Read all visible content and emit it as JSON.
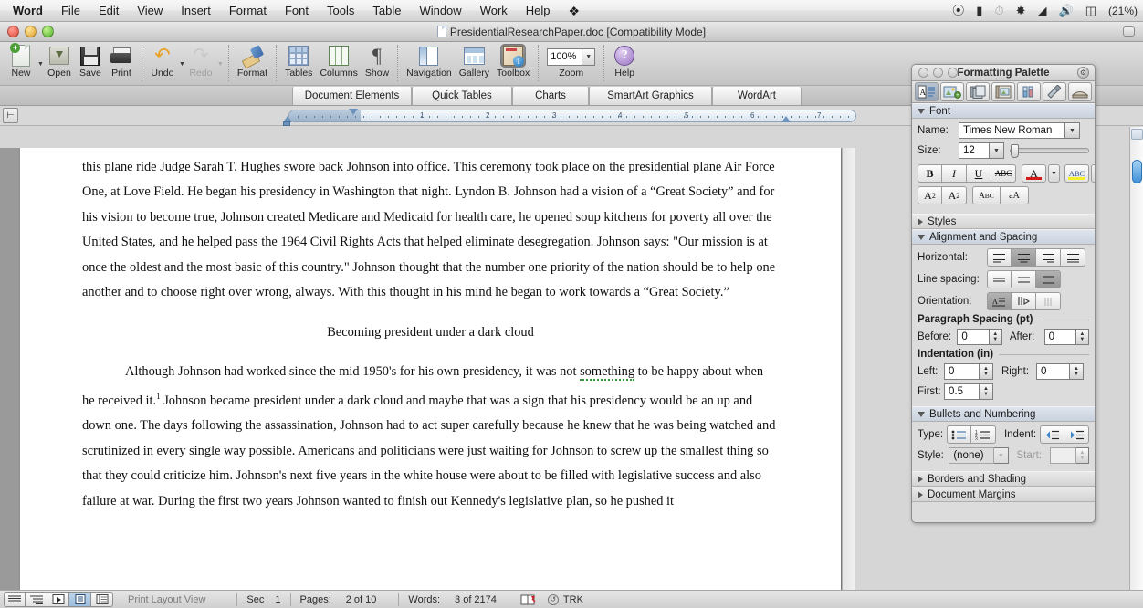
{
  "menubar": {
    "items": [
      "Word",
      "File",
      "Edit",
      "View",
      "Insert",
      "Format",
      "Font",
      "Tools",
      "Table",
      "Window",
      "Work",
      "Help"
    ],
    "spotlight_icon": "spotlight-icon",
    "status_icons": [
      "dropbox-icon",
      "display-icon",
      "time-machine-icon",
      "bluetooth-icon",
      "wifi-icon",
      "volume-icon",
      "battery-icon"
    ],
    "battery_percent": "(21%)"
  },
  "titlebar": {
    "title": "PresidentialResearchPaper.doc [Compatibility Mode]"
  },
  "toolbar": {
    "buttons": [
      {
        "label": "New",
        "icon": "new-document-icon",
        "caret": true,
        "dim": false
      },
      {
        "label": "Open",
        "icon": "open-folder-icon",
        "caret": false,
        "dim": false
      },
      {
        "label": "Save",
        "icon": "save-disk-icon",
        "caret": false,
        "dim": false
      },
      {
        "label": "Print",
        "icon": "printer-icon",
        "caret": false,
        "dim": false
      },
      {
        "label": "Undo",
        "icon": "undo-arrow-icon",
        "caret": true,
        "dim": false
      },
      {
        "label": "Redo",
        "icon": "redo-arrow-icon",
        "caret": true,
        "dim": true
      },
      {
        "label": "Format",
        "icon": "paintbrush-icon",
        "caret": false,
        "dim": false
      },
      {
        "label": "Tables",
        "icon": "table-grid-icon",
        "caret": false,
        "dim": false
      },
      {
        "label": "Columns",
        "icon": "columns-icon",
        "caret": false,
        "dim": false
      },
      {
        "label": "Show",
        "icon": "pilcrow-icon",
        "caret": false,
        "dim": false
      },
      {
        "label": "Navigation",
        "icon": "navigation-pane-icon",
        "caret": false,
        "dim": false
      },
      {
        "label": "Gallery",
        "icon": "gallery-icon",
        "caret": false,
        "dim": false
      },
      {
        "label": "Toolbox",
        "icon": "toolbox-icon",
        "caret": false,
        "dim": false
      },
      {
        "label": "Zoom",
        "icon": "zoom-field",
        "caret": false,
        "dim": false
      },
      {
        "label": "Help",
        "icon": "help-circle-icon",
        "caret": false,
        "dim": false
      }
    ],
    "zoom_value": "100%",
    "active_button": "Toolbox"
  },
  "ribbon": {
    "tabs": [
      "Document Elements",
      "Quick Tables",
      "Charts",
      "SmartArt Graphics",
      "WordArt"
    ]
  },
  "ruler": {
    "tab_stop_icon": "tab-stop-icon",
    "numbers": [
      "1",
      "2",
      "3",
      "4",
      "5",
      "6",
      "7"
    ]
  },
  "document": {
    "paragraphs": [
      {
        "align": "left",
        "runs": [
          {
            "text": "this plane ride Judge Sarah T. Hughes swore back Johnson into office. This ceremony took place on the presidential plane Air Force One, at Love Field. He began his presidency in Washington that night. Lyndon B. Johnson had a vision of a “Great Society” and for his vision to become true, Johnson created Medicare and Medicaid for health care, he opened soup kitchens for poverty all over the United States, and he helped pass the 1964 Civil Rights Acts that helped eliminate desegregation. Johnson says: \"Our mission is at once the oldest and the most basic of this country.\" Johnson thought that the number one priority of the nation should be to help one another and to choose right over wrong, always. With this thought in his mind he began to work towards a “Great Society.”",
            "style": "normal"
          }
        ]
      },
      {
        "align": "center",
        "runs": [
          {
            "text": "Becoming president under a dark cloud",
            "style": "normal"
          }
        ]
      },
      {
        "align": "left",
        "indent": true,
        "runs": [
          {
            "text": "Although Johnson had worked since the mid 1950's for his own presidency, it was not ",
            "style": "normal"
          },
          {
            "text": "something",
            "style": "spelling-error"
          },
          {
            "text": " to be happy about when he received it.",
            "style": "normal"
          },
          {
            "text": "1",
            "style": "footnote-ref"
          },
          {
            "text": " Johnson became president under a dark cloud and maybe that was a sign that his presidency would be an up and down one. The days following the assassination, Johnson had to act super carefully because he knew that he was being watched and scrutinized in every single way possible. Americans and politicians were just waiting for Johnson to screw up the smallest thing so that they could criticize him. Johnson's next five years in the white house were about to be filled with legislative success and also failure at war. During the first two years Johnson wanted to finish out Kennedy's legislative plan, so he pushed it",
            "style": "normal"
          }
        ]
      }
    ]
  },
  "palette": {
    "title": "Formatting Palette",
    "gear_icon": "gear-icon",
    "toolbar_icons": [
      {
        "name": "formatting-palette-icon",
        "selected": true
      },
      {
        "name": "object-palette-icon",
        "selected": false
      },
      {
        "name": "citations-palette-icon",
        "selected": false
      },
      {
        "name": "scrapbook-palette-icon",
        "selected": false
      },
      {
        "name": "reference-tools-icon",
        "selected": false
      },
      {
        "name": "compatibility-report-icon",
        "selected": false
      },
      {
        "name": "toolbox-settings-icon",
        "selected": false
      }
    ],
    "font": {
      "header": "Font",
      "expanded": true,
      "name_label": "Name:",
      "name_value": "Times New Roman",
      "size_label": "Size:",
      "size_value": "12",
      "buttons": [
        {
          "name": "bold-button",
          "glyph": "B"
        },
        {
          "name": "italic-button",
          "glyph": "I"
        },
        {
          "name": "underline-button",
          "glyph": "U"
        },
        {
          "name": "strikethrough-button",
          "glyph": "ABC"
        },
        {
          "name": "font-color-button",
          "glyph": "A"
        },
        {
          "name": "highlight-button",
          "glyph": "ABC"
        },
        {
          "name": "superscript-button",
          "glyph": "A2"
        },
        {
          "name": "subscript-button",
          "glyph": "A2"
        },
        {
          "name": "small-caps-button",
          "glyph": "ABC"
        },
        {
          "name": "change-case-button",
          "glyph": "aA"
        }
      ]
    },
    "styles": {
      "header": "Styles",
      "expanded": false
    },
    "alignment": {
      "header": "Alignment and Spacing",
      "expanded": true,
      "horizontal_label": "Horizontal:",
      "horizontal_selected": 1,
      "line_spacing_label": "Line spacing:",
      "line_spacing_selected": 2,
      "orientation_label": "Orientation:",
      "orientation_selected": 0,
      "paragraph_spacing_legend": "Paragraph Spacing (pt)",
      "before_label": "Before:",
      "before_value": "0",
      "after_label": "After:",
      "after_value": "0",
      "indentation_legend": "Indentation (in)",
      "left_label": "Left:",
      "left_value": "0",
      "right_label": "Right:",
      "right_value": "0",
      "first_label": "First:",
      "first_value": "0.5"
    },
    "bullets": {
      "header": "Bullets and Numbering",
      "expanded": true,
      "type_label": "Type:",
      "indent_label": "Indent:",
      "style_label": "Style:",
      "style_value": "(none)",
      "start_label": "Start:",
      "start_value": ""
    },
    "borders": {
      "header": "Borders and Shading",
      "expanded": false
    },
    "margins": {
      "header": "Document Margins",
      "expanded": false
    }
  },
  "statusbar": {
    "view_buttons": [
      "draft-view-button",
      "outline-view-button",
      "publishing-layout-button",
      "print-layout-button",
      "notebook-layout-button"
    ],
    "view_selected": 3,
    "view_label": "Print Layout View",
    "sec_label": "Sec",
    "sec_value": "1",
    "pages_label": "Pages:",
    "pages_value": "2 of 10",
    "words_label": "Words:",
    "words_value": "3 of 2174",
    "spell_icon": "spell-check-icon",
    "track_changes_icon": "track-changes-icon",
    "track_changes_label": "TRK"
  },
  "colors": {
    "accent": "#3f90d8",
    "spelling_error": "#2f9c3a",
    "font_color_swatch": "#d41919",
    "highlight_swatch": "#f5f02a"
  }
}
